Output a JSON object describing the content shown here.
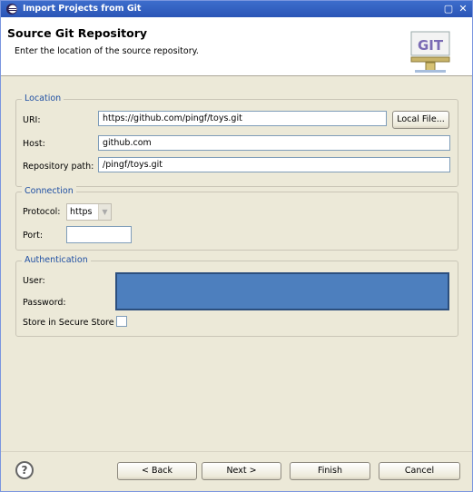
{
  "window": {
    "title": "Import Projects from Git",
    "minimize_icon": "minimize-icon",
    "close_icon": "close-icon"
  },
  "header": {
    "title": "Source Git Repository",
    "description": "Enter the location of the source repository.",
    "logo_text": "GIT"
  },
  "location": {
    "legend": "Location",
    "uri_label": "URI:",
    "uri_value": "https://github.com/pingf/toys.git",
    "local_file_button": "Local File...",
    "host_label": "Host:",
    "host_value": "github.com",
    "repo_path_label": "Repository path:",
    "repo_path_value": "/pingf/toys.git"
  },
  "connection": {
    "legend": "Connection",
    "protocol_label": "Protocol:",
    "protocol_value": "https",
    "port_label": "Port:",
    "port_value": ""
  },
  "authentication": {
    "legend": "Authentication",
    "user_label": "User:",
    "password_label": "Password:",
    "store_label": "Store in Secure Store",
    "store_checked": false
  },
  "footer": {
    "help_icon": "help-icon",
    "back_button": "< Back",
    "next_button": "Next >",
    "finish_button": "Finish",
    "cancel_button": "Cancel"
  },
  "colors": {
    "title_bar": "#2a55b6",
    "legend_text": "#1f4fa3",
    "redaction": "#4d7fbe"
  }
}
